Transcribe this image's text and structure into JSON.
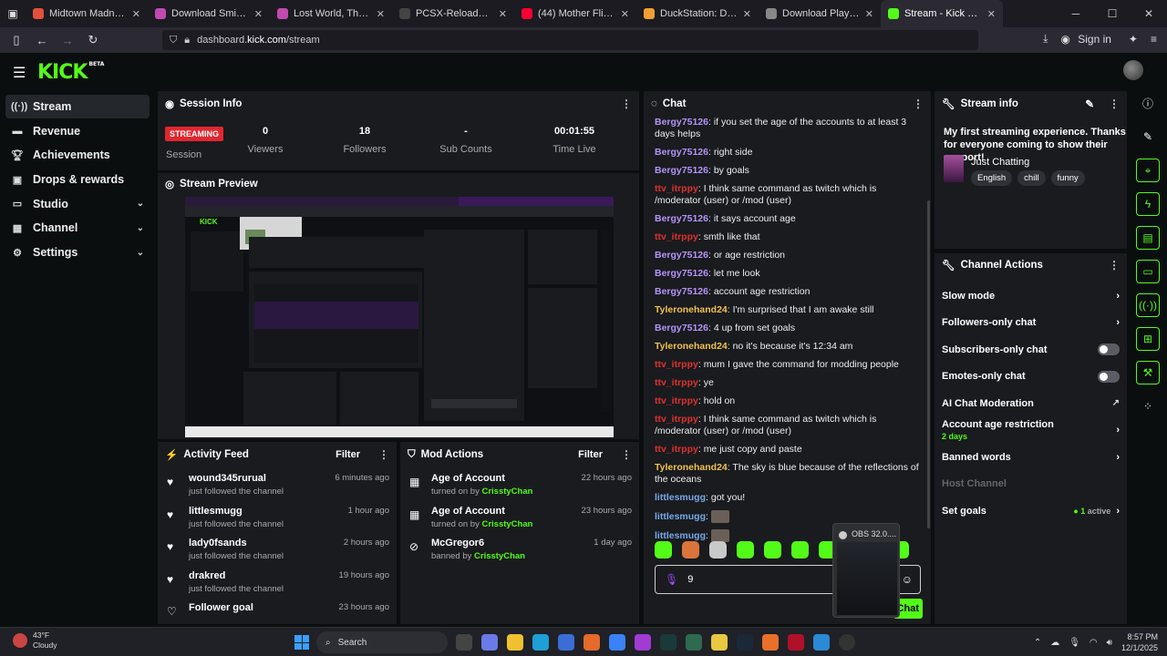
{
  "browser": {
    "tabs": [
      {
        "label": "Midtown Madness 1 & 2 D",
        "color": "#e2513b"
      },
      {
        "label": "Download Smithsonian Ins",
        "color": "#c04ab0"
      },
      {
        "label": "Lost World, The: Jurassic Pa",
        "color": "#c04ab0"
      },
      {
        "label": "PCSX-Reloaded PSX emulat",
        "color": "#444"
      },
      {
        "label": "(44) Mother Flippin' T.Rex!",
        "color": "#ff0033"
      },
      {
        "label": "DuckStation: Download W",
        "color": "#f0a030"
      },
      {
        "label": "Download PlayStation 1 BI",
        "color": "#888"
      },
      {
        "label": "Stream - Kick Dashboard",
        "color": "#53fc18"
      }
    ],
    "url_prefix": "dashboard.",
    "url_domain": "kick.com",
    "url_path": "/stream",
    "sign_in": "Sign in"
  },
  "logo": {
    "text": "KICK",
    "badge": "BETA"
  },
  "sidebar": {
    "items": [
      {
        "label": "Stream",
        "icon": "broadcast-icon",
        "selected": true,
        "chevron": false
      },
      {
        "label": "Revenue",
        "icon": "revenue-icon",
        "selected": false,
        "chevron": false
      },
      {
        "label": "Achievements",
        "icon": "trophy-icon",
        "selected": false,
        "chevron": false
      },
      {
        "label": "Drops & rewards",
        "icon": "gift-icon",
        "selected": false,
        "chevron": false
      },
      {
        "label": "Studio",
        "icon": "studio-icon",
        "selected": false,
        "chevron": true
      },
      {
        "label": "Channel",
        "icon": "channel-icon",
        "selected": false,
        "chevron": true
      },
      {
        "label": "Settings",
        "icon": "gear-icon",
        "selected": false,
        "chevron": true
      }
    ]
  },
  "session": {
    "title": "Session Info",
    "status": "STREAMING",
    "status_label": "Session",
    "stats": [
      {
        "value": "0",
        "label": "Viewers"
      },
      {
        "value": "18",
        "label": "Followers"
      },
      {
        "value": "-",
        "label": "Sub Counts"
      },
      {
        "value": "00:01:55",
        "label": "Time Live"
      }
    ]
  },
  "preview": {
    "title": "Stream Preview"
  },
  "activity": {
    "title": "Activity Feed",
    "filter": "Filter",
    "items": [
      {
        "name": "wound345rurual",
        "sub": "just followed the channel",
        "time": "6 minutes ago",
        "icon": "heart-icon"
      },
      {
        "name": "littlesmugg",
        "sub": "just followed the channel",
        "time": "1 hour ago",
        "icon": "heart-icon"
      },
      {
        "name": "lady0fsands",
        "sub": "just followed the channel",
        "time": "2 hours ago",
        "icon": "heart-icon"
      },
      {
        "name": "drakred",
        "sub": "just followed the channel",
        "time": "19 hours ago",
        "icon": "heart-icon"
      },
      {
        "name": "Follower goal",
        "sub": "",
        "time": "23 hours ago",
        "icon": "heart-outline-icon"
      }
    ]
  },
  "mod": {
    "title": "Mod Actions",
    "filter": "Filter",
    "items": [
      {
        "name": "Age of Account",
        "prefix": "turned on by ",
        "by": "CrisstyChan",
        "time": "22 hours ago",
        "icon": "calendar-icon"
      },
      {
        "name": "Age of Account",
        "prefix": "turned on by ",
        "by": "CrisstyChan",
        "time": "23 hours ago",
        "icon": "calendar-icon"
      },
      {
        "name": "McGregor6",
        "prefix": "banned by ",
        "by": "CrisstyChan",
        "time": "1 day ago",
        "icon": "ban-icon"
      }
    ]
  },
  "chat": {
    "title": "Chat",
    "messages": [
      {
        "user": "Bergy75126",
        "color": "#b693f7",
        "text": "if you set the age of the accounts to at least 3 days helps"
      },
      {
        "user": "Bergy75126",
        "color": "#b693f7",
        "text": "right side"
      },
      {
        "user": "Bergy75126",
        "color": "#b693f7",
        "text": "by goals"
      },
      {
        "user": "ttv_itrppy",
        "color": "#e0312c",
        "text": "I think same command as twitch which is /moderator (user) or /mod (user)"
      },
      {
        "user": "Bergy75126",
        "color": "#b693f7",
        "text": "it says account age"
      },
      {
        "user": "ttv_itrppy",
        "color": "#e0312c",
        "text": "smth like that"
      },
      {
        "user": "Bergy75126",
        "color": "#b693f7",
        "text": "or age restriction"
      },
      {
        "user": "Bergy75126",
        "color": "#b693f7",
        "text": "let me look"
      },
      {
        "user": "Bergy75126",
        "color": "#b693f7",
        "text": "account age restriction"
      },
      {
        "user": "Tyleronehand24",
        "color": "#f2c14e",
        "text": "I'm surprised that I am awake still"
      },
      {
        "user": "Bergy75126",
        "color": "#b693f7",
        "text": "4 up from set goals"
      },
      {
        "user": "Tyleronehand24",
        "color": "#f2c14e",
        "text": "no it's because it's 12:34 am"
      },
      {
        "user": "ttv_itrppy",
        "color": "#e0312c",
        "text": "mum I gave the command for modding people"
      },
      {
        "user": "ttv_itrppy",
        "color": "#e0312c",
        "text": "ye"
      },
      {
        "user": "ttv_itrppy",
        "color": "#e0312c",
        "text": "hold on"
      },
      {
        "user": "ttv_itrppy",
        "color": "#e0312c",
        "text": "I think same command as twitch which is /moderator (user) or /mod (user)"
      },
      {
        "user": "ttv_itrppy",
        "color": "#e0312c",
        "text": "me just copy and paste"
      },
      {
        "user": "Tyleronehand24",
        "color": "#f2c14e",
        "text": "The sky is blue because of the reflections of the oceans"
      },
      {
        "user": "littlesmugg",
        "color": "#78a8e8",
        "text": "got you!"
      },
      {
        "user": "littlesmugg",
        "color": "#78a8e8",
        "text": ""
      },
      {
        "user": "littlesmugg",
        "color": "#78a8e8",
        "text": ""
      }
    ],
    "input_value": "9",
    "send_label": "Chat"
  },
  "stream_info": {
    "title": "Stream info",
    "stream_title": "My first streaming experience. Thanks for everyone coming to show their support!",
    "category": "Just Chatting",
    "tags": [
      "English",
      "chill",
      "funny"
    ]
  },
  "channel_actions": {
    "title": "Channel Actions",
    "items": [
      {
        "label": "Slow mode",
        "type": "chevron"
      },
      {
        "label": "Followers-only chat",
        "type": "chevron"
      },
      {
        "label": "Subscribers-only chat",
        "type": "toggle"
      },
      {
        "label": "Emotes-only chat",
        "type": "toggle"
      },
      {
        "label": "AI Chat Moderation",
        "type": "external"
      },
      {
        "label": "Account age restriction",
        "sub": "2 days",
        "type": "chevron"
      },
      {
        "label": "Banned words",
        "type": "chevron"
      },
      {
        "label": "Host Channel",
        "type": "disabled"
      },
      {
        "label": "Set goals",
        "type": "chevron",
        "badge_count": "1",
        "badge_text": " active"
      }
    ]
  },
  "obs_popup": {
    "title": "OBS 32.0...."
  },
  "taskbar": {
    "temp": "43°F",
    "cond": "Cloudy",
    "search": "Search",
    "time": "8:57 PM",
    "date": "12/1/2025"
  }
}
